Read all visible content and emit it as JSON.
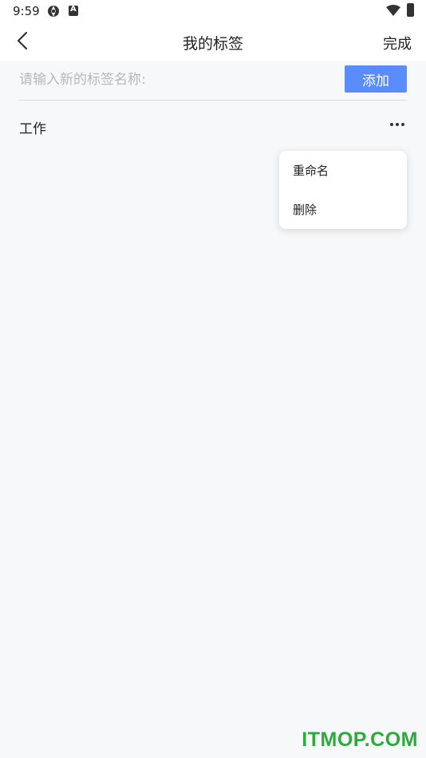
{
  "status_bar": {
    "time": "9:59",
    "icons": [
      "aperture-icon",
      "a-badge-icon",
      "wifi-icon",
      "battery-icon"
    ]
  },
  "nav": {
    "back_icon": "chevron-left-icon",
    "title": "我的标签",
    "done_label": "完成"
  },
  "input": {
    "value": "",
    "placeholder": "请输入新的标签名称:",
    "add_label": "添加"
  },
  "tags": [
    {
      "label": "工作",
      "menu_icon": "more-horizontal-icon"
    }
  ],
  "popup_menu": {
    "items": [
      {
        "label": "重命名"
      },
      {
        "label": "删除"
      }
    ]
  },
  "watermark": "ITMOP.COM",
  "colors": {
    "accent": "#5b8cff",
    "background": "#f7f8fa",
    "text": "#222222",
    "placeholder": "#b4b7bd",
    "watermark": "#2eaa3c"
  }
}
